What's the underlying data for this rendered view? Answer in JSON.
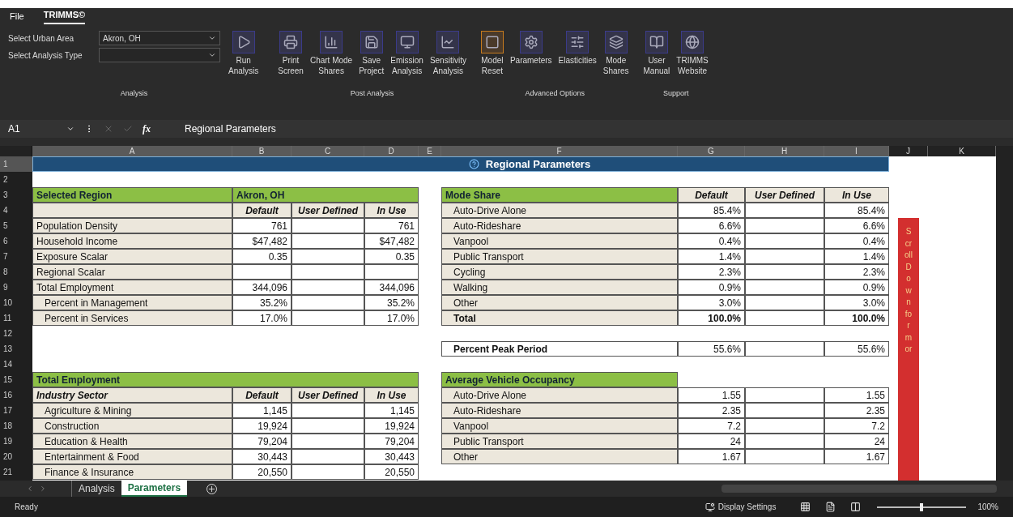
{
  "menu": [
    {
      "label": "File",
      "selected": false
    },
    {
      "label": "TRIMMS©",
      "selected": true
    }
  ],
  "ribbon": {
    "fields": [
      {
        "label": "Select Urban Area",
        "value": "Akron, OH"
      },
      {
        "label": "Select Analysis Type"
      }
    ],
    "groups": [
      {
        "label": "Analysis",
        "buttons": [
          {
            "lines": [
              "Run",
              "Analysis"
            ]
          }
        ]
      },
      {
        "label": "Post Analysis",
        "buttons": [
          {
            "lines": [
              "Print",
              "Screen"
            ]
          },
          {
            "lines": [
              "Chart Mode",
              "Shares"
            ]
          },
          {
            "lines": [
              "Save",
              "Project"
            ]
          },
          {
            "lines": [
              "Emission",
              "Analysis"
            ]
          },
          {
            "lines": [
              "Sensitivity",
              "Analysis"
            ]
          }
        ]
      },
      {
        "label": "Advanced Options",
        "buttons": [
          {
            "lines": [
              "Model",
              "Reset"
            ]
          },
          {
            "lines": [
              "Parameters"
            ]
          },
          {
            "lines": [
              "Elasticities"
            ]
          },
          {
            "lines": [
              "Mode",
              "Shares"
            ]
          }
        ]
      },
      {
        "label": "Support",
        "buttons": [
          {
            "lines": [
              "User",
              "Manual"
            ]
          },
          {
            "lines": [
              "TRIMMS",
              "Website"
            ]
          }
        ]
      }
    ]
  },
  "formula_bar": {
    "cell": "A1",
    "function_label": "fx",
    "formula": "Regional Parameters"
  },
  "columns": [
    "A",
    "B",
    "C",
    "D",
    "E",
    "F",
    "G",
    "H",
    "I",
    "J",
    "K"
  ],
  "rows": [
    "1",
    "2",
    "3",
    "4",
    "5",
    "6",
    "7",
    "8",
    "9",
    "10",
    "11",
    "12",
    "13",
    "14",
    "15",
    "16",
    "17",
    "18",
    "19",
    "20",
    "21"
  ],
  "sheet": {
    "title": "Regional Parameters",
    "region": {
      "label": "Selected Region",
      "value": "Akron, OH",
      "columns": [
        "Default",
        "User Defined",
        "In Use"
      ],
      "items": [
        {
          "label": "Population Density",
          "default": "761",
          "in_use": "761"
        },
        {
          "label": "Household Income",
          "default": "$47,482",
          "in_use": "$47,482"
        },
        {
          "label": "Exposure Scalar",
          "default": "0.35",
          "in_use": "0.35"
        },
        {
          "label": "Regional Scalar"
        },
        {
          "label": "Total Employment",
          "default": "344,096",
          "in_use": "344,096",
          "children": [
            {
              "label": "Percent in Management",
              "default": "35.2%",
              "in_use": "35.2%"
            },
            {
              "label": "Percent in Services",
              "default": "17.0%",
              "in_use": "17.0%"
            }
          ]
        }
      ]
    },
    "mode_share": {
      "label": "Mode Share",
      "columns": [
        "Default",
        "User Defined",
        "In Use"
      ],
      "items": [
        {
          "kind": "item",
          "label": "Auto-Drive Alone",
          "default": "85.4%",
          "in_use": "85.4%"
        },
        {
          "kind": "item",
          "label": "Auto-Rideshare",
          "default": "6.6%",
          "in_use": "6.6%"
        },
        {
          "kind": "item",
          "label": "Vanpool",
          "default": "0.4%",
          "in_use": "0.4%"
        },
        {
          "kind": "item",
          "label": "Public Transport",
          "default": "1.4%",
          "in_use": "1.4%"
        },
        {
          "kind": "item",
          "label": "Cycling",
          "default": "2.3%",
          "in_use": "2.3%"
        },
        {
          "kind": "item",
          "label": "Walking",
          "default": "0.9%",
          "in_use": "0.9%"
        },
        {
          "kind": "item",
          "label": "Other",
          "default": "3.0%",
          "in_use": "3.0%"
        },
        {
          "kind": "total",
          "label": "Total",
          "default": "100.0%",
          "in_use": "100.0%"
        }
      ]
    },
    "peak": {
      "label": "Percent Peak Period",
      "default": "55.6%",
      "in_use": "55.6%"
    },
    "employment": {
      "label": "Total Employment",
      "header": "Industry Sector",
      "columns": [
        "Default",
        "User Defined",
        "In Use"
      ],
      "items": [
        {
          "label": "Agriculture & Mining",
          "default": "1,145",
          "in_use": "1,145"
        },
        {
          "label": "Construction",
          "default": "19,924",
          "in_use": "19,924"
        },
        {
          "label": "Education & Health",
          "default": "79,204",
          "in_use": "79,204"
        },
        {
          "label": "Entertainment & Food",
          "default": "30,443",
          "in_use": "30,443"
        },
        {
          "label": "Finance & Insurance",
          "default": "20,550",
          "in_use": "20,550"
        }
      ]
    },
    "occupancy": {
      "label": "Average Vehicle Occupancy",
      "items": [
        {
          "label": "Auto-Drive Alone",
          "default": "1.55",
          "in_use": "1.55"
        },
        {
          "label": "Auto-Rideshare",
          "default": "2.35",
          "in_use": "2.35"
        },
        {
          "label": "Vanpool",
          "default": "7.2",
          "in_use": "7.2"
        },
        {
          "label": "Public Transport",
          "default": "24",
          "in_use": "24"
        },
        {
          "label": "Other",
          "default": "1.67",
          "in_use": "1.67"
        }
      ]
    },
    "scroll_banner": "Scroll Down for mor"
  },
  "sheet_tabs": [
    {
      "label": "Analysis",
      "selected": false
    },
    {
      "label": "Parameters",
      "selected": true
    }
  ],
  "status": {
    "text": "Ready",
    "display_settings": "Display Settings",
    "zoom": {
      "level": 0.5,
      "reading": "100%"
    }
  }
}
